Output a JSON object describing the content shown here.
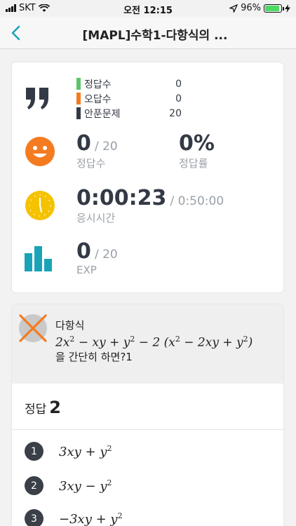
{
  "status_bar": {
    "carrier": "SKT",
    "time": "오전 12:15",
    "battery": "96%"
  },
  "nav": {
    "title": "[MAPL]수학1-다항식의 ..."
  },
  "summary": {
    "legend": [
      {
        "label": "정답수",
        "value": "0",
        "color": "#5cc46a"
      },
      {
        "label": "오답수",
        "value": "0",
        "color": "#f47b20"
      },
      {
        "label": "안푼문제",
        "value": "20",
        "color": "#333a45"
      }
    ],
    "correct": {
      "value": "0",
      "total": "/ 20",
      "caption": "정답수"
    },
    "rate": {
      "value": "0%",
      "caption": "정답률"
    },
    "time": {
      "value": "0:00:23",
      "limit": "/ 0:50:00",
      "caption": "응시시간"
    },
    "exp": {
      "value": "0",
      "total": "/ 20",
      "caption": "EXP"
    }
  },
  "question": {
    "topic": "다항식",
    "suffix": "을 간단히 하면?1",
    "answer_label": "정답",
    "answer_value": "2",
    "options": [
      {
        "number": "1"
      },
      {
        "number": "2"
      },
      {
        "number": "3"
      }
    ]
  },
  "colors": {
    "accent": "#1aa3b8",
    "orange": "#f47b20",
    "yellow": "#f5c200",
    "dark": "#333a45"
  }
}
